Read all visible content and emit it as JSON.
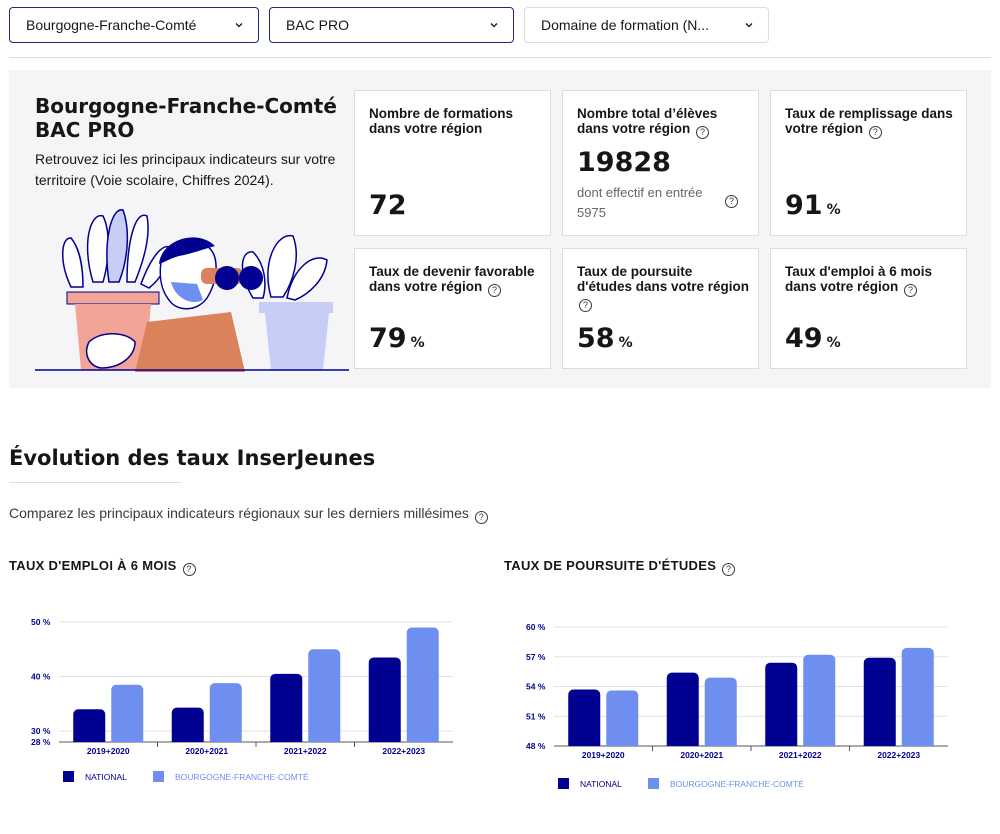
{
  "filters": {
    "region": "Bourgogne-Franche-Comté",
    "diploma": "BAC PRO",
    "domain": "Domaine de formation (N..."
  },
  "summary": {
    "title_line1": "Bourgogne-Franche-Comté",
    "title_line2": "BAC PRO",
    "description": "Retrouvez ici les principaux indicateurs sur votre territoire (Voie scolaire, Chiffres 2024)."
  },
  "cards": {
    "formations": {
      "label": "Nombre de formations dans votre région",
      "value": "72"
    },
    "eleves": {
      "label": "Nombre total d’élèves dans votre région",
      "value": "19828",
      "sub": "dont effectif en entrée 5975"
    },
    "remplissage": {
      "label": "Taux de remplissage dans votre région",
      "value": "91",
      "unit": "%"
    },
    "devenir": {
      "label": "Taux de devenir favorable dans votre région",
      "value": "79",
      "unit": "%"
    },
    "poursuite": {
      "label": "Taux de poursuite d'études dans votre région",
      "value": "58",
      "unit": "%"
    },
    "emploi": {
      "label": "Taux d'emploi à 6 mois dans votre région",
      "value": "49",
      "unit": "%"
    }
  },
  "section": {
    "title": "Évolution des taux InserJeunes",
    "description": "Comparez les principaux indicateurs régionaux sur les derniers millésimes"
  },
  "colors": {
    "national": "#000091",
    "region": "#6e8ff0",
    "panel_bg": "#f5f5f7"
  },
  "chart_data": [
    {
      "type": "bar",
      "title": "TAUX D'EMPLOI À 6 MOIS",
      "categories": [
        "2019+2020",
        "2020+2021",
        "2021+2022",
        "2022+2023"
      ],
      "series": [
        {
          "name": "NATIONAL",
          "values": [
            34,
            34.3,
            40.5,
            43.5
          ]
        },
        {
          "name": "BOURGOGNE-FRANCHE-COMTÉ",
          "values": [
            38.5,
            38.8,
            45,
            49
          ]
        }
      ],
      "ylim": [
        28,
        50
      ],
      "yticks": [
        28,
        30,
        40,
        50
      ],
      "ytick_labels": [
        "28 %",
        "30 %",
        "40 %",
        "50 %"
      ],
      "legend": "bottom-left",
      "grid": true
    },
    {
      "type": "bar",
      "title": "TAUX DE POURSUITE D'ÉTUDES",
      "categories": [
        "2019+2020",
        "2020+2021",
        "2021+2022",
        "2022+2023"
      ],
      "series": [
        {
          "name": "NATIONAL",
          "values": [
            53.7,
            55.4,
            56.4,
            56.9
          ]
        },
        {
          "name": "BOURGOGNE-FRANCHE-COMTÉ",
          "values": [
            53.6,
            54.9,
            57.2,
            57.9
          ]
        }
      ],
      "ylim": [
        48,
        60
      ],
      "yticks": [
        48,
        51,
        54,
        57,
        60
      ],
      "ytick_labels": [
        "48 %",
        "51 %",
        "54 %",
        "57 %",
        "60 %"
      ],
      "legend": "bottom-left",
      "grid": true
    }
  ]
}
